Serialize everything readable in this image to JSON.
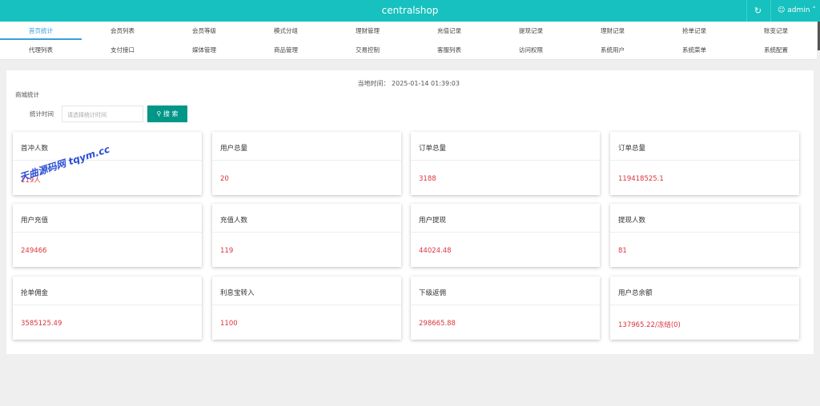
{
  "header": {
    "title": "centralshop",
    "refresh_icon": "refresh-icon",
    "user": "admin"
  },
  "nav": {
    "row1": [
      "首页统计",
      "会员列表",
      "会员等级",
      "模式分组",
      "理财管理",
      "充值记录",
      "提现记录",
      "理财记录",
      "抢单记录",
      "账变记录"
    ],
    "row2": [
      "代理列表",
      "支付接口",
      "媒体管理",
      "商品管理",
      "交易控制",
      "客服列表",
      "访问权限",
      "系统用户",
      "系统菜单",
      "系统配置"
    ],
    "active": "首页统计"
  },
  "main": {
    "current_time": "当地时间： 2025-01-14 01:39:03",
    "section": "商城统计",
    "filter_label": "统计时间",
    "filter_placeholder": "请选择统计时间",
    "search_label": "搜 索"
  },
  "cards": [
    {
      "title": "首冲人数",
      "value": "119人"
    },
    {
      "title": "用户总量",
      "value": "20"
    },
    {
      "title": "订单总量",
      "value": "3188"
    },
    {
      "title": "订单总量",
      "value": "119418525.1"
    },
    {
      "title": "用户充值",
      "value": "249466"
    },
    {
      "title": "充值人数",
      "value": "119"
    },
    {
      "title": "用户提现",
      "value": "44024.48"
    },
    {
      "title": "提现人数",
      "value": "81"
    },
    {
      "title": "抢单佣金",
      "value": "3585125.49"
    },
    {
      "title": "利息宝转入",
      "value": "1100"
    },
    {
      "title": "下级返佣",
      "value": "298665.88"
    },
    {
      "title": "用户总余额",
      "value": "137965.22/冻结(0)"
    }
  ],
  "watermark": "天曲源码网 tqym.cc",
  "colors": {
    "header": "#16c1bf",
    "accent": "#3a9ee0",
    "button": "#009688",
    "value": "#d9363e"
  }
}
